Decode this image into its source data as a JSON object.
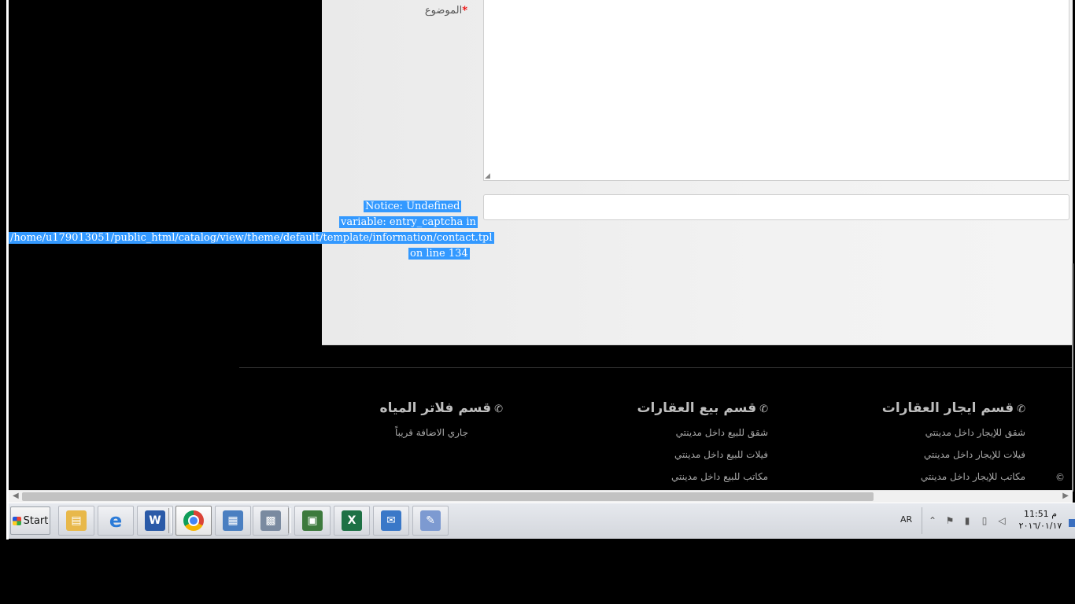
{
  "form": {
    "subject_label": "الموضوع",
    "required_mark": "*",
    "captcha_notice_lines": [
      "Notice: Undefined",
      "variable: entry_captcha in",
      "/home/u179013051/public_html/catalog/view/theme/default/template/information/contact.tpl",
      "on line 134"
    ],
    "textarea_value": "",
    "captcha_value": ""
  },
  "footer": {
    "columns": [
      {
        "title": "قسم ايجار العقارات",
        "links": [
          "شقق للإيجار داخل مدينتي",
          "فيلات للإيجار داخل مدينتي",
          "مكاتب للإيجار داخل مدينتي"
        ]
      },
      {
        "title": "قسم بيع العقارات",
        "links": [
          "شقق للبيع داخل مدينتي",
          "فيلات للبيع داخل مدينتي",
          "مكاتب للبيع داخل مدينتي"
        ]
      },
      {
        "title": "قسم فلاتر المياه",
        "links": [
          "جاري الاضافة قريباً"
        ]
      }
    ],
    "copyright": "©"
  },
  "taskbar": {
    "start_label": "Start",
    "language": "AR",
    "clock_time": "11:51 م",
    "clock_date": "٢٠١٦/٠١/١٧",
    "apps": [
      {
        "name": "file-explorer-icon",
        "color": "#e8b84a"
      },
      {
        "name": "internet-explorer-icon",
        "color": "#2b7bd8"
      },
      {
        "name": "word-icon",
        "color": "#2a5aa8"
      },
      {
        "name": "chrome-icon",
        "color": "#db4437"
      },
      {
        "name": "control-panel-icon",
        "color": "#4a7fc1"
      },
      {
        "name": "calculator-icon",
        "color": "#7a8aa0"
      },
      {
        "name": "remote-desktop-icon",
        "color": "#3d7a3d"
      },
      {
        "name": "excel-icon",
        "color": "#1e7145"
      },
      {
        "name": "send-to-icon",
        "color": "#3a78c8"
      },
      {
        "name": "paint-icon",
        "color": "#7d9ad1"
      }
    ]
  }
}
